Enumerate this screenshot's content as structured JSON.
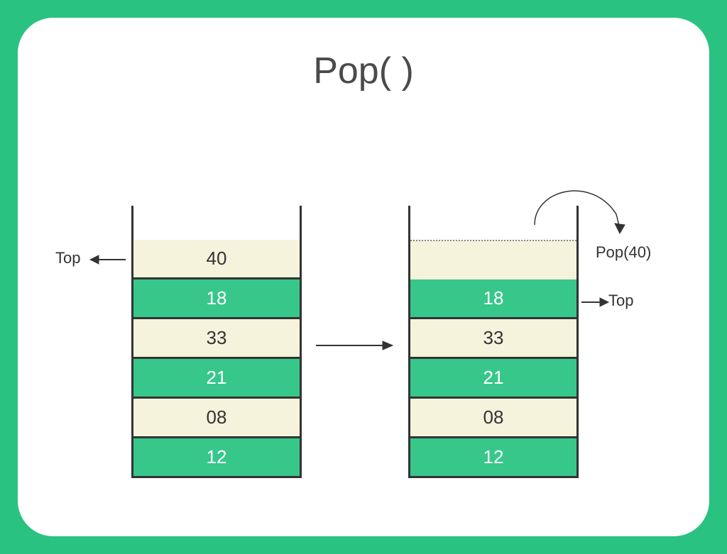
{
  "title": "Pop( )",
  "labels": {
    "topLeft": "Top",
    "topRight": "Top",
    "popOut": "Pop(40)"
  },
  "stackBefore": {
    "cells": [
      {
        "value": "40",
        "color": "cream"
      },
      {
        "value": "18",
        "color": "green"
      },
      {
        "value": "33",
        "color": "cream"
      },
      {
        "value": "21",
        "color": "green"
      },
      {
        "value": "08",
        "color": "cream"
      },
      {
        "value": "12",
        "color": "green"
      }
    ]
  },
  "stackAfter": {
    "cells": [
      {
        "value": "",
        "color": "empty"
      },
      {
        "value": "18",
        "color": "green"
      },
      {
        "value": "33",
        "color": "cream"
      },
      {
        "value": "21",
        "color": "green"
      },
      {
        "value": "08",
        "color": "cream"
      },
      {
        "value": "12",
        "color": "green"
      }
    ]
  },
  "chart_data": {
    "type": "diagram",
    "operation": "Pop()",
    "before": {
      "top": "40",
      "elements": [
        40,
        18,
        33,
        21,
        8,
        12
      ]
    },
    "after": {
      "top": "18",
      "elements": [
        18,
        33,
        21,
        8,
        12
      ],
      "popped": 40
    }
  }
}
